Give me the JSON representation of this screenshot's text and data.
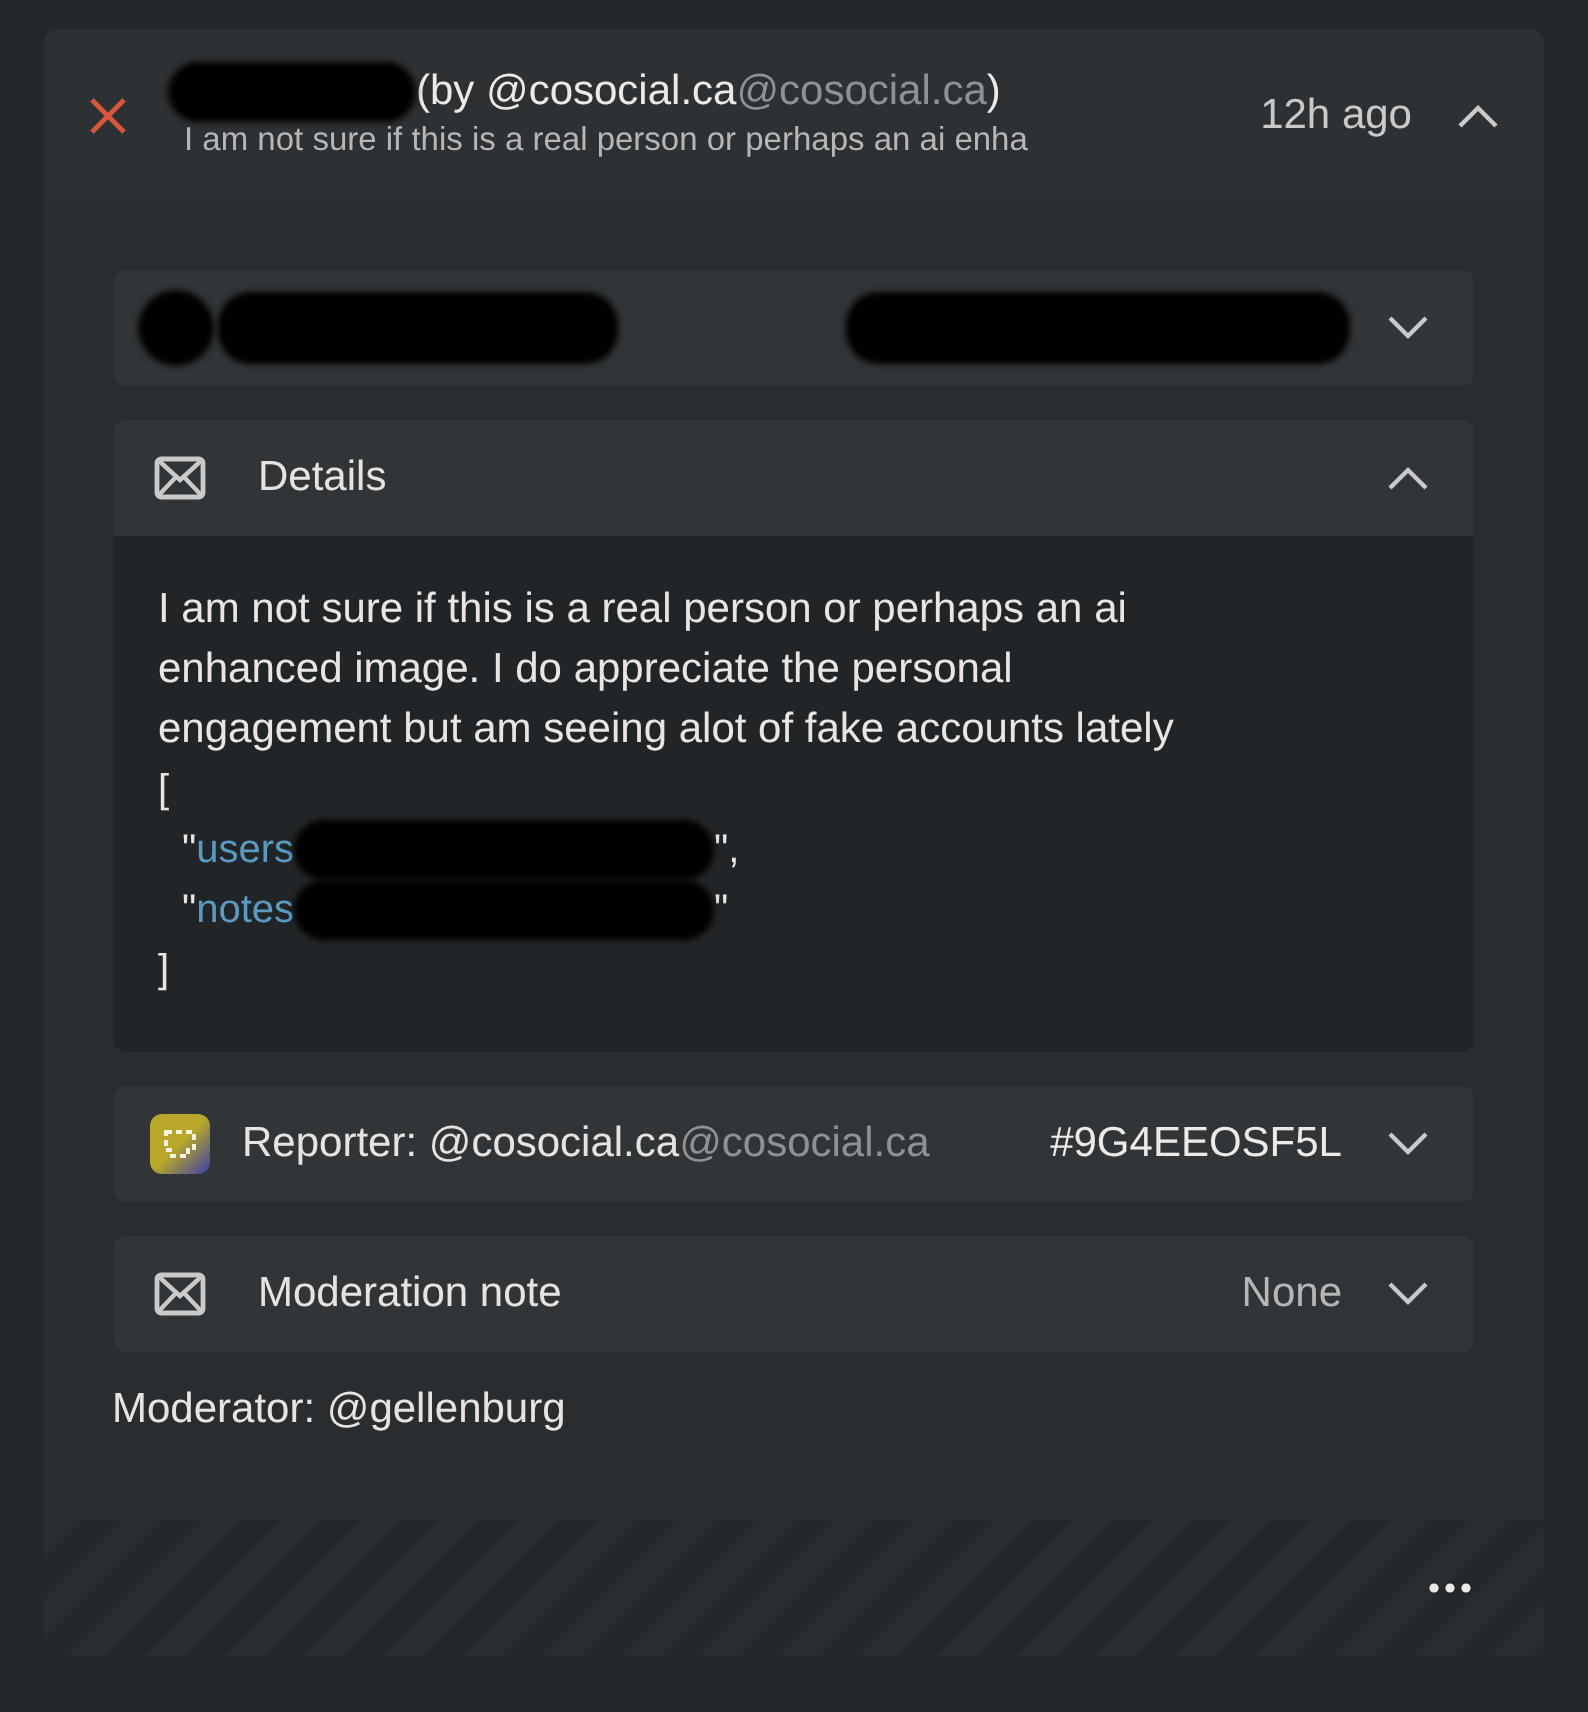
{
  "report": {
    "resolved": true,
    "author_handle": "(by @cosocial.ca",
    "author_domain": "@cosocial.ca",
    "author_close": ")",
    "summary": "I am not sure if this is a real person or perhaps an ai enha",
    "time": "12h ago",
    "expanded": true
  },
  "sections": [
    {
      "kind": "redacted",
      "expanded": false
    },
    {
      "kind": "details",
      "title": "Details",
      "expanded": true,
      "text": "I am not sure if this is a real person or perhaps an ai\nenhanced image. I do appreciate the personal\nengagement but am seeing alot of fake accounts lately",
      "code_open": "[",
      "code_lines": [
        {
          "quote": "\"",
          "key": "users",
          "end": "\","
        },
        {
          "quote": "\"",
          "key": "notes",
          "end": "\""
        }
      ],
      "code_close": "]"
    },
    {
      "kind": "reporter",
      "label": "Reporter: @cosocial.ca",
      "domain": "@cosocial.ca",
      "value": "#9G4EEOSF5L",
      "expanded": false
    },
    {
      "kind": "note",
      "title": "Moderation note",
      "value": "None",
      "expanded": false
    }
  ],
  "moderator": "Moderator: @gellenburg"
}
